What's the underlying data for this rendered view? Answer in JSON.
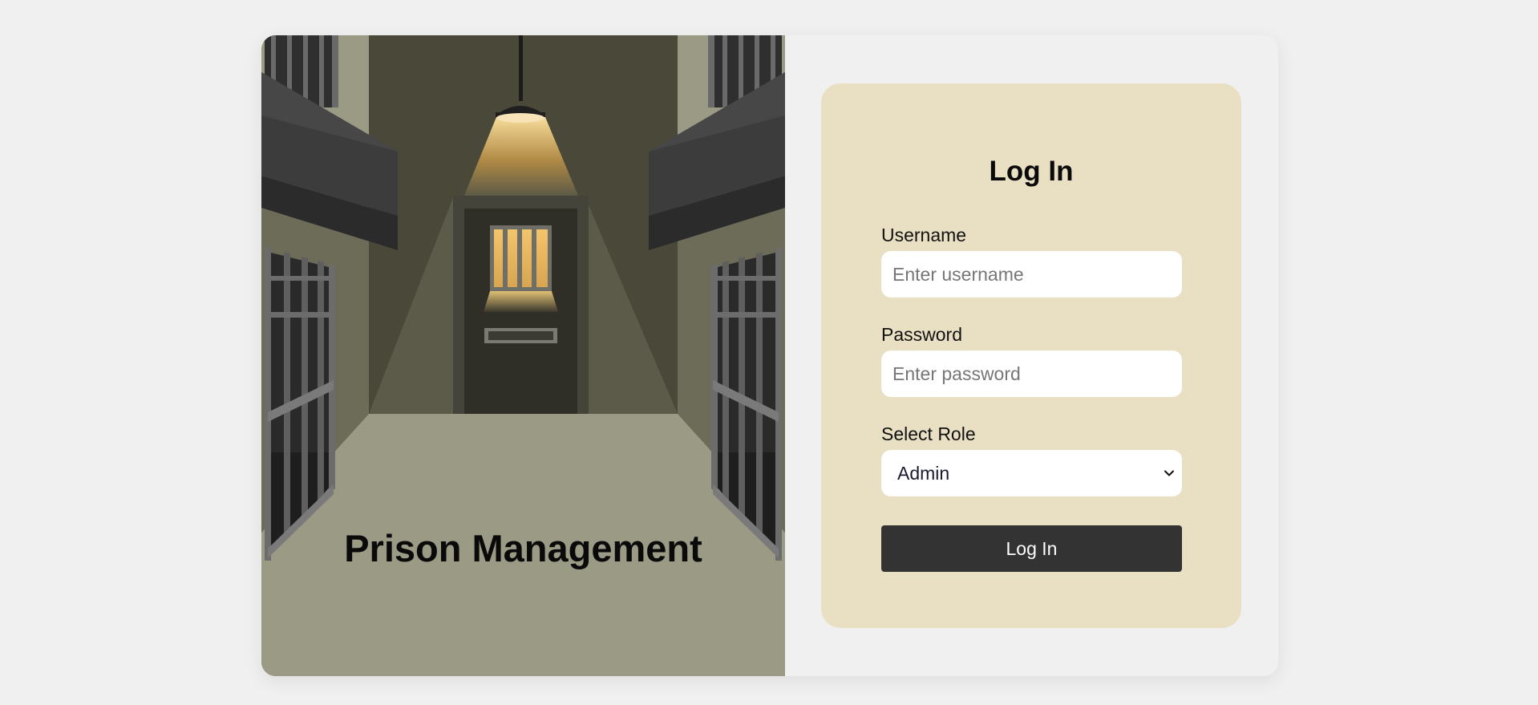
{
  "brand": {
    "title": "Prison Management"
  },
  "login": {
    "title": "Log In",
    "username": {
      "label": "Username",
      "placeholder": "Enter username",
      "value": ""
    },
    "password": {
      "label": "Password",
      "placeholder": "Enter password",
      "value": ""
    },
    "role": {
      "label": "Select Role",
      "selected": "Admin"
    },
    "submit_label": "Log In"
  },
  "colors": {
    "page_bg": "#f0f0f0",
    "form_panel_bg": "#e9e0c4",
    "button_bg": "#333333",
    "floor": "#9b9a85",
    "back_wall": "#4a4838",
    "lamp_glow": "#f5c56a"
  },
  "icons": {
    "role_dropdown": "chevron-down-icon"
  }
}
